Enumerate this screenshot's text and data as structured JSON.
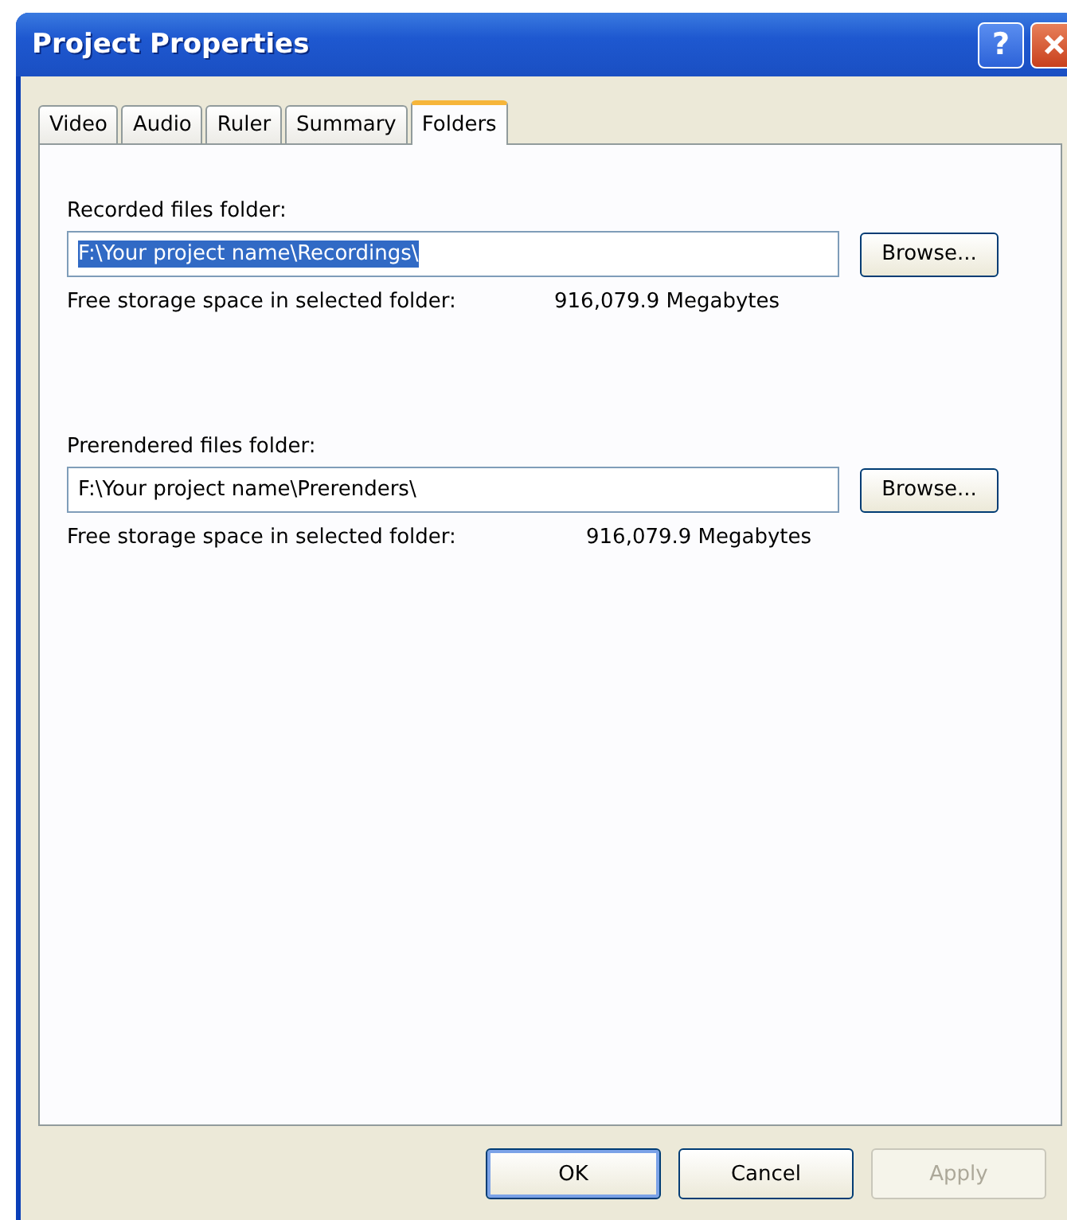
{
  "window": {
    "title": "Project Properties",
    "help_button": "?"
  },
  "tabs": [
    {
      "label": "Video",
      "selected": false
    },
    {
      "label": "Audio",
      "selected": false
    },
    {
      "label": "Ruler",
      "selected": false
    },
    {
      "label": "Summary",
      "selected": false
    },
    {
      "label": "Folders",
      "selected": true
    }
  ],
  "sections": [
    {
      "label": "Recorded files folder:",
      "value": "F:\\Your project name\\Recordings\\",
      "text_selected": true,
      "browse": "Browse...",
      "free_label": "Free storage space in selected folder:",
      "free_value": "916,079.9 Megabytes"
    },
    {
      "label": "Prerendered files folder:",
      "value": "F:\\Your project name\\Prerenders\\",
      "text_selected": false,
      "browse": "Browse...",
      "free_label": "Free storage space in selected folder:",
      "free_value": "916,079.9 Megabytes"
    }
  ],
  "buttons": [
    {
      "label": "OK",
      "disabled": false,
      "default": true
    },
    {
      "label": "Cancel",
      "disabled": false,
      "default": false
    },
    {
      "label": "Apply",
      "disabled": true,
      "default": false
    }
  ]
}
